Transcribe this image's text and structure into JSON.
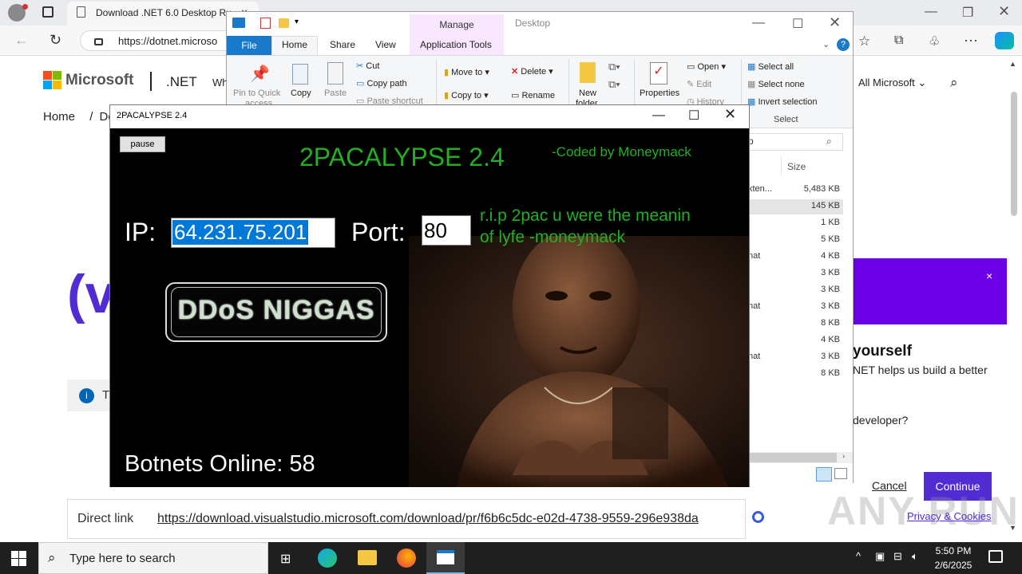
{
  "browser": {
    "tab_title": "Download .NET 6.0 Desktop Ru",
    "url": "https://dotnet.microso",
    "address_secure_icon": "lock-icon"
  },
  "webpage": {
    "brand": "Microsoft",
    "product": ".NET",
    "nav_partial": "Wh",
    "all_microsoft": "All Microsoft",
    "breadcrumb_home": "Home",
    "breadcrumb_sep": "/",
    "breadcrumb_partial": "Do",
    "big_partial": "(v",
    "info_partial": "T",
    "direct_link_label": "Direct link",
    "direct_link_url": "https://download.visualstudio.microsoft.com/download/pr/f6b6c5dc-e02d-4738-9559-296e938da",
    "popup_close": "×",
    "popup_title": "yourself",
    "popup_body": "NET helps us build a better",
    "popup_question": "developer?",
    "cancel": "Cancel",
    "continue": "Continue",
    "privacy": "Privacy & Cookies",
    "watermark": "ANY RUN",
    "brand_colors": [
      "#f25022",
      "#7fba00",
      "#00a4ef",
      "#ffb900"
    ],
    "accent": "#512bd4"
  },
  "explorer": {
    "manage": "Manage",
    "desktop": "Desktop",
    "tabs": [
      "File",
      "Home",
      "Share",
      "View",
      "Application Tools"
    ],
    "ribbon": {
      "pin": "Pin to Quick",
      "pin2": "access",
      "copy": "Copy",
      "paste": "Paste",
      "cut": "Cut",
      "copy_path": "Copy path",
      "paste_shortcut": "Paste shortcut",
      "move_to": "Move to",
      "copy_to": "Copy to",
      "delete": "Delete",
      "rename": "Rename",
      "new_folder": "New",
      "new_folder2": "folder",
      "properties": "Properties",
      "open": "Open",
      "edit": "Edit",
      "history": "History",
      "select_all": "Select all",
      "select_none": "Select none",
      "invert_selection": "Invert selection",
      "select_group": "Select"
    },
    "search_partial": "p",
    "size_header": "Size",
    "rows": [
      {
        "name": "kten...",
        "size": "5,483 KB"
      },
      {
        "name": "",
        "size": "145 KB"
      },
      {
        "name": "",
        "size": "1 KB"
      },
      {
        "name": "",
        "size": "5 KB"
      },
      {
        "name": "nat",
        "size": "4 KB"
      },
      {
        "name": "",
        "size": "3 KB"
      },
      {
        "name": "",
        "size": "3 KB"
      },
      {
        "name": "nat",
        "size": "3 KB"
      },
      {
        "name": "",
        "size": "8 KB"
      },
      {
        "name": "",
        "size": "4 KB"
      },
      {
        "name": "nat",
        "size": "3 KB"
      },
      {
        "name": "",
        "size": "8 KB"
      }
    ]
  },
  "app": {
    "window_title": "2PACALYPSE 2.4",
    "pause": "pause",
    "heading": "2PACALYPSE 2.4",
    "coder": "-Coded by Moneymack",
    "ip_label": "IP:",
    "ip_value": "64.231.75.201",
    "port_label": "Port:",
    "port_value": "80",
    "rip_line1": "r.i.p 2pac u were the meanin",
    "rip_line2": "of lyfe -moneymack",
    "ddos_button": "DDoS NIGGAS",
    "botnets": "Botnets Online: 58",
    "text_color": "#22b022"
  },
  "taskbar": {
    "search_placeholder": "Type here to search",
    "time": "5:50 PM",
    "date": "2/6/2025"
  }
}
